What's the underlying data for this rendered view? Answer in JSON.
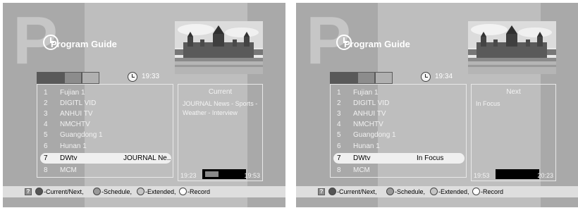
{
  "screens": [
    {
      "logo_letter": "P",
      "title": "Program Guide",
      "time": "19:33",
      "channels": [
        {
          "num": "1",
          "name": "Fujian 1"
        },
        {
          "num": "2",
          "name": "DIGITL VID"
        },
        {
          "num": "3",
          "name": "ANHUI TV"
        },
        {
          "num": "4",
          "name": "NMCHTV"
        },
        {
          "num": "5",
          "name": "Guangdong 1"
        },
        {
          "num": "6",
          "name": "Hunan 1"
        },
        {
          "num": "7",
          "name": "DWtv",
          "program": "JOURNAL Ne.."
        },
        {
          "num": "8",
          "name": "MCM"
        }
      ],
      "selected_index": 6,
      "info": {
        "heading": "Current",
        "text": "JOURNAL News - Sports - Weather - Interview",
        "start": "19:23",
        "end": "19:53",
        "progress": 0.35
      }
    },
    {
      "logo_letter": "P",
      "title": "Program Guide",
      "time": "19:34",
      "channels": [
        {
          "num": "1",
          "name": "Fujian 1"
        },
        {
          "num": "2",
          "name": "DIGITL VID"
        },
        {
          "num": "3",
          "name": "ANHUI TV"
        },
        {
          "num": "4",
          "name": "NMCHTV"
        },
        {
          "num": "5",
          "name": "Guangdong 1"
        },
        {
          "num": "6",
          "name": "Hunan 1"
        },
        {
          "num": "7",
          "name": "DWtv",
          "program": "In Focus"
        },
        {
          "num": "8",
          "name": "MCM"
        }
      ],
      "selected_index": 6,
      "info": {
        "heading": "Next",
        "text": "In Focus",
        "start": "19:53",
        "end": "20:23",
        "progress": 0
      }
    }
  ],
  "legend": {
    "help": "?",
    "items": [
      {
        "label": "-Current/Next,",
        "color": "#555555"
      },
      {
        "label": "-Schedule,",
        "color": "#9a9a9a"
      },
      {
        "label": "-Extended,",
        "color": "#c4c4c4"
      },
      {
        "label": "-Record",
        "color": "#ffffff"
      }
    ]
  },
  "icons": [
    "clock-icon",
    "help-icon",
    "color-key-icon"
  ]
}
